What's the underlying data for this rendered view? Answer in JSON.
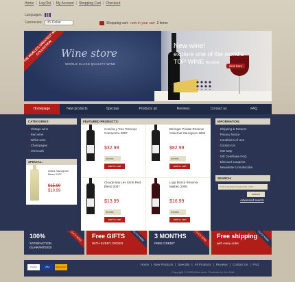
{
  "toplinks": [
    "Home",
    "Log Out",
    "My Account",
    "Shopping Cart",
    "Checkout"
  ],
  "languages_label": "Languages:",
  "currencies_label": "Currencies:",
  "currency_value": "US Dollar",
  "cart": {
    "label": "Shopping cart:",
    "now": "now in your cart",
    "items": "2 items"
  },
  "banner": {
    "ribbon": "THE WORLD'S GREATEST WINE COLLECTION",
    "logo": "Wine store",
    "tagline": "WORLD CLASS QUALITY WINE",
    "new": "New wine!",
    "explore": "explore one of the world's",
    "top": "TOP WINE",
    "region": "REGION",
    "click": "click here"
  },
  "nav": [
    "Homepage",
    "New products",
    "Specials",
    "Products all",
    "Reviews",
    "Contact us",
    "FAQ"
  ],
  "categories": {
    "title": "CATEGORIES:",
    "items": [
      "Vintage wine",
      "Red wine",
      "White wine",
      "Champagne",
      "Vermouth"
    ]
  },
  "special": {
    "title": "SPECIAL:",
    "name": "Adiva Sauvignon Blanc 2007",
    "old": "$15.99",
    "new": "$10.99"
  },
  "featured": {
    "title": "FEATURED PRODUCTS:",
    "details": "details",
    "addcart": "add to cart",
    "products": [
      {
        "name": "Concha y Toro Terrunyo Carmenere 2007",
        "price": "$32.99"
      },
      {
        "name": "Beringer Private Reserve Cabernet Sauvignon 1996",
        "price": "$82.99"
      },
      {
        "name": "Cloudy Bay Les Sorte Red Blend 2007",
        "price": "$13.99"
      },
      {
        "name": "Luigi Bosca Reserva Malbec 2008",
        "price": "$16.99"
      }
    ]
  },
  "information": {
    "title": "INFORMATION:",
    "items": [
      "Shipping & Returns",
      "Privacy Notice",
      "Conditions of Use",
      "Contact Us",
      "Site Map",
      "Gift Certificate FAQ",
      "Discount Coupons",
      "Newsletter Unsubscribe"
    ]
  },
  "search": {
    "title": "SEARCH:",
    "placeholder": "enter search keywords here",
    "button": "search",
    "advanced": "Advanced search"
  },
  "promos": [
    {
      "t1": "100%",
      "t2": "SATISFACTION",
      "t3": "GUARANTEED!",
      "corner": "CLICK HERE"
    },
    {
      "t1": "Free GIFTS",
      "t2": "WITH EVERY ORDER",
      "t3": "",
      "corner": "CLICK HERE"
    },
    {
      "t1": "3 MONTHS",
      "t2": "FREE CREDIT",
      "t3": "",
      "corner": "CLICK HERE"
    },
    {
      "t1": "Free shipping",
      "t2": "with every order",
      "t3": "",
      "corner": "CLICK HERE"
    }
  ],
  "footer": {
    "cards": [
      "PayPal",
      "VISA",
      "MasterCard"
    ],
    "links": [
      "Home",
      "New Products",
      "Specials",
      "All Products",
      "Reviews",
      "Contact Us",
      "FAQ"
    ],
    "copyright": "Copyright © 2009 Wine store. Powered by Zen Cart"
  }
}
